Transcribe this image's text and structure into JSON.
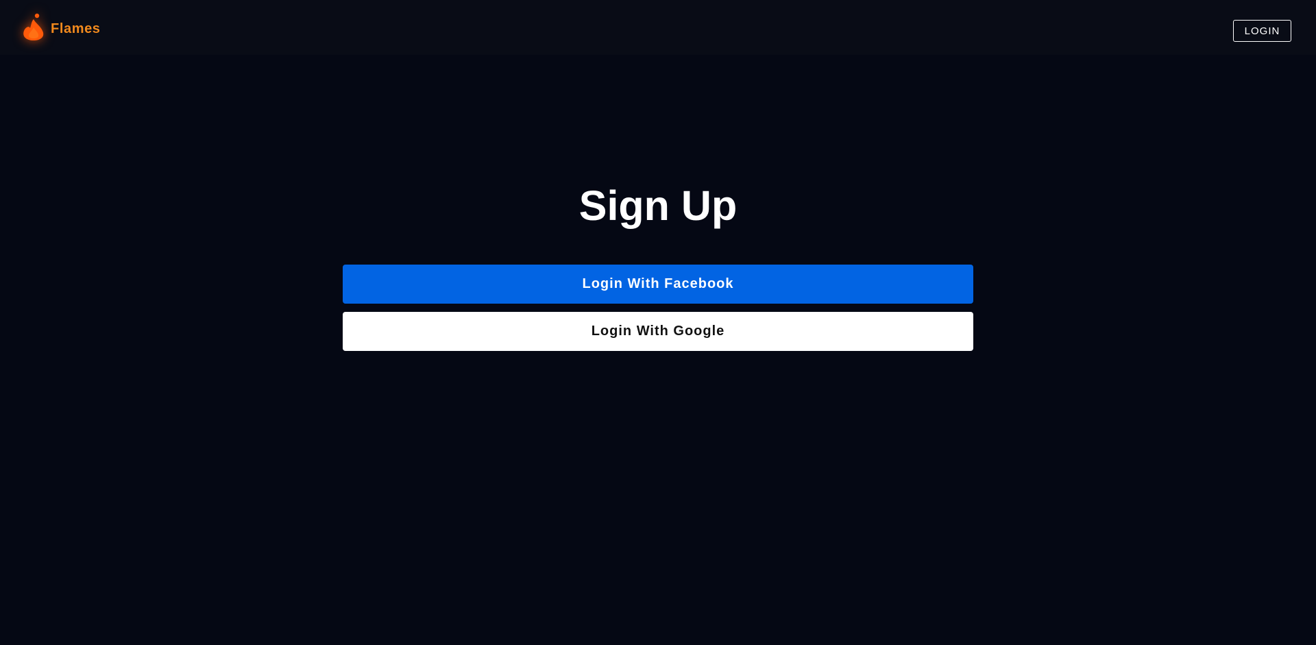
{
  "navbar": {
    "brand_name": "Flames",
    "logo_icon": "flame-icon",
    "login_label": "LOGIN"
  },
  "main": {
    "title": "Sign Up",
    "facebook_label": "Login With Facebook",
    "google_label": "Login With Google"
  },
  "colors": {
    "background": "#050814",
    "navbar_background": "#090c16",
    "brand_accent": "#f28a1d",
    "facebook_blue": "#0264e3",
    "google_white": "#ffffff"
  }
}
